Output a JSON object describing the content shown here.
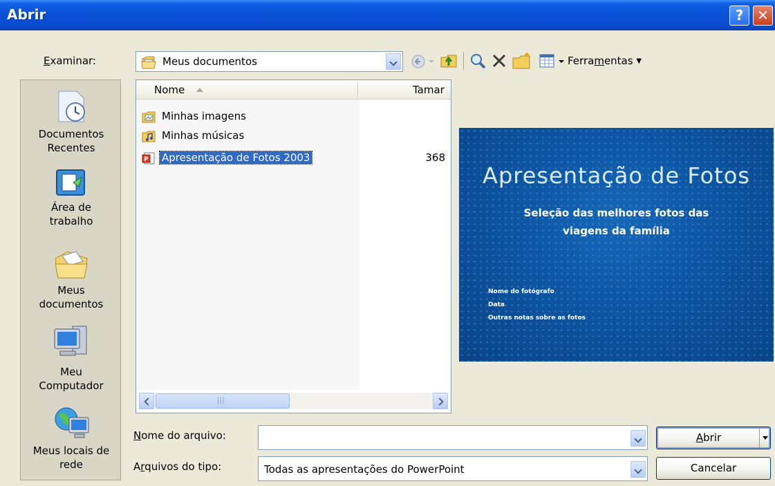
{
  "window": {
    "title": "Abrir",
    "help_label": "?",
    "close_label": "✕"
  },
  "lookin": {
    "label_u": "E",
    "label_rest": "xaminar:",
    "value": "Meus documentos"
  },
  "toolbar": {
    "tools_label_pre": "Ferra",
    "tools_label_u": "m",
    "tools_label_post": "entas"
  },
  "places": [
    {
      "label_1": "Documentos",
      "label_2": "Recentes",
      "icon": "recent-documents-icon"
    },
    {
      "label_1": "Área de",
      "label_2": "trabalho",
      "icon": "desktop-icon"
    },
    {
      "label_1": "Meus",
      "label_2": "documentos",
      "icon": "my-documents-icon"
    },
    {
      "label_1": "Meu",
      "label_2": "Computador",
      "icon": "my-computer-icon"
    },
    {
      "label_1": "Meus locais de",
      "label_2": "rede",
      "icon": "network-places-icon"
    }
  ],
  "filelist": {
    "col_name": "Nome",
    "col_size": "Tamar",
    "rows": [
      {
        "name": "Minhas imagens",
        "size": "",
        "icon": "pictures-folder-icon"
      },
      {
        "name": "Minhas músicas",
        "size": "",
        "icon": "music-folder-icon"
      },
      {
        "name": "Apresentação de Fotos 2003",
        "size": "368",
        "icon": "powerpoint-file-icon",
        "selected": true
      }
    ]
  },
  "preview": {
    "title": "Apresentação de Fotos",
    "subtitle": "Seleção das melhores fotos das viagens da família",
    "line_1": "Nome do fotógrafo",
    "line_2": "Data",
    "line_3": "Outras notas sobre as fotos"
  },
  "filename": {
    "label_u": "N",
    "label_rest": "ome do arquivo:",
    "value": ""
  },
  "filetype": {
    "label_pre": "A",
    "label_u": "r",
    "label_rest": "quivos do tipo:",
    "value": "Todas as apresentações do PowerPoint"
  },
  "buttons": {
    "open_u": "A",
    "open_rest": "brir",
    "cancel": "Cancelar"
  }
}
